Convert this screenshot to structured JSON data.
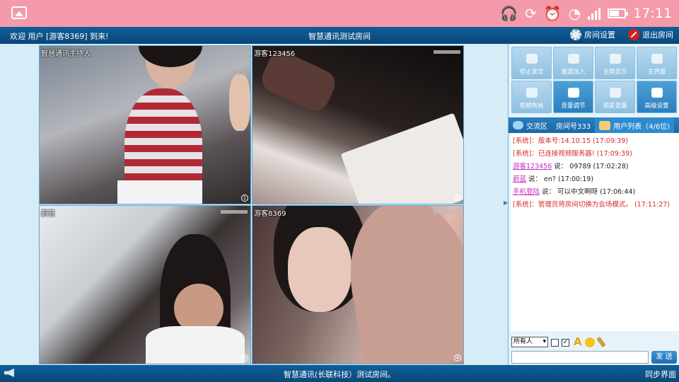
{
  "statusbar": {
    "time": "17:11",
    "icons": [
      "gallery-icon",
      "headset-icon",
      "sync-icon",
      "alarm-icon",
      "wifi-icon",
      "signal-icon",
      "battery-icon"
    ]
  },
  "header": {
    "welcome": "欢迎 用户 [游客8369] 到来!",
    "title": "智慧通讯测试房间",
    "room_settings": "房间设置",
    "exit_room": "退出房间"
  },
  "videos": [
    {
      "label": "智慧通讯主持人",
      "index": "1"
    },
    {
      "label": "游客123456",
      "index": "2"
    },
    {
      "label": "蔚蓝",
      "index": "3"
    },
    {
      "label": "游客8369",
      "index": "4"
    }
  ],
  "toolbar": {
    "buttons": [
      {
        "label": "停止发言",
        "icon": "hand-icon",
        "active": false
      },
      {
        "label": "邀请加入",
        "icon": "person-icon",
        "active": false
      },
      {
        "label": "全屏显示",
        "icon": "fullscreen-icon",
        "active": false
      },
      {
        "label": "主界面",
        "icon": "home-icon",
        "active": false
      },
      {
        "label": "视频布局",
        "icon": "layout-icon",
        "active": false
      },
      {
        "label": "音量调节",
        "icon": "speaker-icon",
        "active": true
      },
      {
        "label": "调麦音量",
        "icon": "mic-icon",
        "active": false
      },
      {
        "label": "高级设置",
        "icon": "gear-icon",
        "active": true
      }
    ]
  },
  "tabs": {
    "chat": "交流区",
    "room": "房间号333",
    "users": "用户列表（4/6位)"
  },
  "chat": {
    "messages": [
      {
        "type": "sys",
        "text": "[系统]：版本号:14.10.15  (17:09:39)"
      },
      {
        "type": "sys",
        "text": "[系统]：已连接视频服务器! (17:09:39)"
      },
      {
        "type": "user",
        "user": "游客123456",
        "text": " 说： 09789 (17:02:28)"
      },
      {
        "type": "user",
        "user": "蔚蓝",
        "text": " 说： en? (17:00:19)"
      },
      {
        "type": "user",
        "user": "手机登陆",
        "text": " 说： 可以中文啊呀 (17:06:44)"
      },
      {
        "type": "sys",
        "text": "[系统]：管理员将房间切换为会场模式。 (17:11:27)"
      }
    ]
  },
  "composer": {
    "recipient": "所有人",
    "send": "发 送"
  },
  "footer": {
    "notice": "智慧通讯(长联科技）测试房间。",
    "sync": "同步界面"
  },
  "colors": {
    "statusbar": "#f49aab",
    "header": "#0f5f9a",
    "system_message": "#d62b2b",
    "user_link": "#c42fc1"
  }
}
